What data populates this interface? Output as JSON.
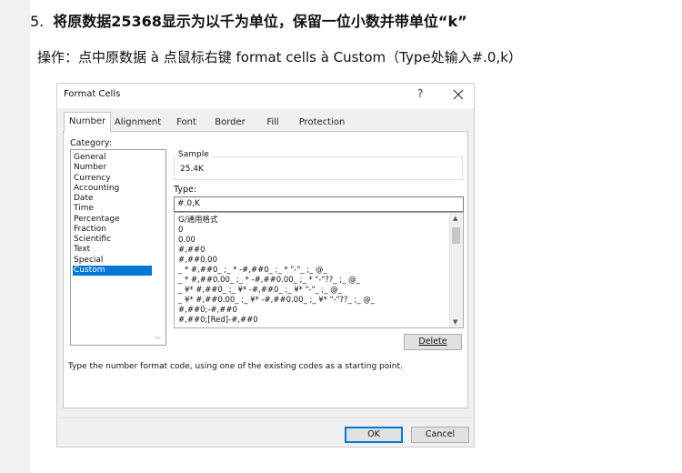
{
  "doc": {
    "step_number": "5.",
    "heading": "将原数据25368显示为以千为单位，保留一位小数并带单位“k”",
    "instruction": "操作：点中原数据 à 点鼠标右键 format cells à Custom（Type处输入#.0,k）"
  },
  "dialog": {
    "title": "Format Cells",
    "help_label": "?",
    "tabs": [
      "Number",
      "Alignment",
      "Font",
      "Border",
      "Fill",
      "Protection"
    ],
    "category_label": "Category:",
    "categories": [
      "General",
      "Number",
      "Currency",
      "Accounting",
      "Date",
      "Time",
      "Percentage",
      "Fraction",
      "Scientific",
      "Text",
      "Special",
      "Custom"
    ],
    "selected_category": "Custom",
    "sample_label": "Sample",
    "sample_value": "25.4K",
    "type_label": "Type:",
    "type_value": "#.0,K",
    "formats": [
      "G/通用格式",
      "0",
      "0.00",
      "#,##0",
      "#,##0.00",
      "_ * #,##0_ ;_ * -#,##0_ ;_ * \"-\"_ ;_ @_",
      "_ * #,##0.00_ ;_ * -#,##0.00_ ;_ * \"-\"??_ ;_ @_",
      "_ ¥* #,##0_ ;_ ¥* -#,##0_ ;_ ¥* \"-\"_ ;_ @_",
      "_ ¥* #,##0.00_ ;_ ¥* -#,##0.00_ ;_ ¥* \"-\"??_ ;_ @_",
      "#,##0;-#,##0",
      "#,##0;[Red]-#,##0"
    ],
    "delete_label": "Delete",
    "hint": "Type the number format code, using one of the existing codes as a starting point.",
    "ok_label": "OK",
    "cancel_label": "Cancel"
  }
}
